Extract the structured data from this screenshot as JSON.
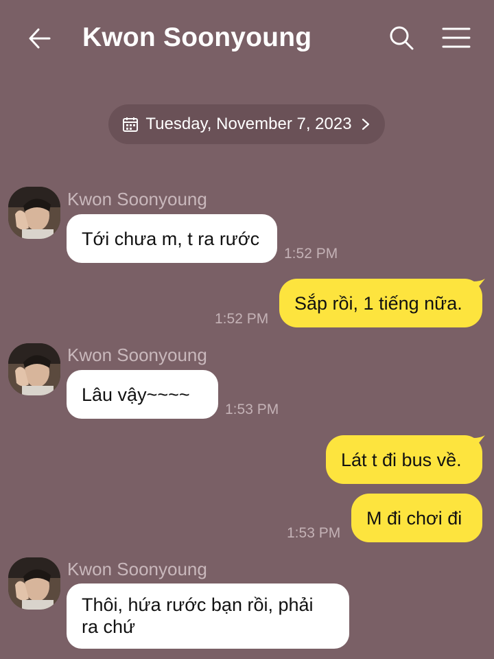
{
  "header": {
    "title": "Kwon Soonyoung",
    "back_icon": "arrow-left-icon",
    "search_icon": "search-icon",
    "menu_icon": "hamburger-menu-icon"
  },
  "date_divider": {
    "label": "Tuesday, November 7, 2023",
    "icon": "calendar-icon"
  },
  "colors": {
    "background": "#7a6066",
    "incoming_bubble": "#ffffff",
    "outgoing_bubble": "#fde43e",
    "meta_text": "#c4b2b6"
  },
  "messages": [
    {
      "direction": "in",
      "sender": "Kwon Soonyoung",
      "text": "Tới chưa m, t ra rước",
      "time": "1:52 PM"
    },
    {
      "direction": "out",
      "text": "Sắp rồi, 1 tiếng nữa.",
      "time": "1:52 PM"
    },
    {
      "direction": "in",
      "sender": "Kwon Soonyoung",
      "text": "Lâu vậy~~~~",
      "time": "1:53 PM"
    },
    {
      "direction": "out",
      "text": "Lát t đi bus về."
    },
    {
      "direction": "out",
      "text": "M đi chơi đi",
      "time": "1:53 PM"
    },
    {
      "direction": "in",
      "sender": "Kwon Soonyoung",
      "text_line1": "Thôi, hứa rước bạn rồi, phải",
      "text_line2": "ra chứ"
    }
  ]
}
